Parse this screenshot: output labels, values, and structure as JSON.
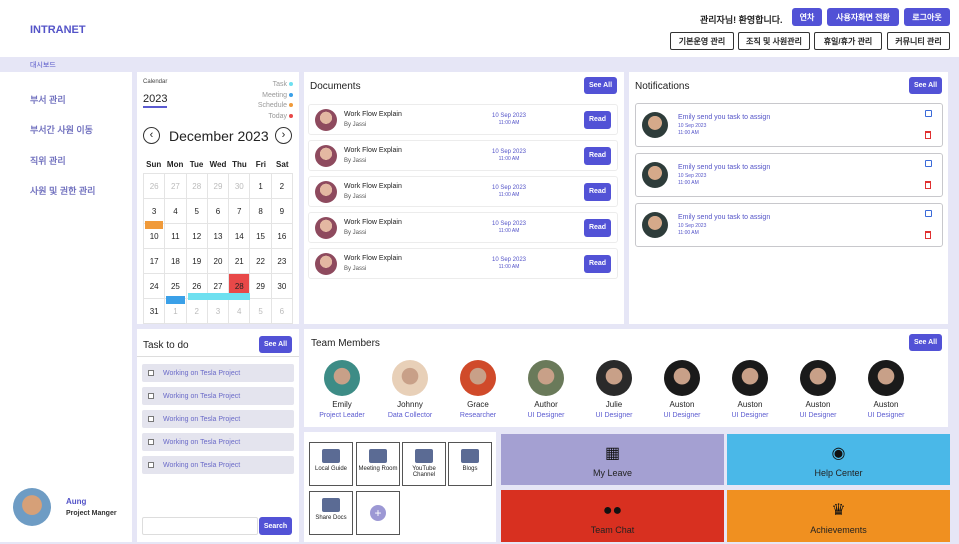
{
  "brand": "INTRANET",
  "header": {
    "welcome": "관리자님! 환영합니다.",
    "btn_leave": "연차",
    "btn_switch": "사용자화면 전환",
    "btn_logout": "로그아웃",
    "tabs": [
      "기본운영 관리",
      "조직 및 사원관리",
      "휴일/휴가 관리",
      "커뮤니티 관리"
    ]
  },
  "breadcrumb": "대시보드",
  "sidebar": {
    "items": [
      "부서 관리",
      "부서간 사원 이동",
      "직위 관리",
      "사원 및 권한 관리"
    ],
    "user_name": "Aung",
    "user_role": "Project Manger"
  },
  "calendar": {
    "label": "Calendar",
    "year": "2023",
    "month": "December 2023",
    "legend": [
      {
        "label": "Task",
        "color": "#6ee0f0"
      },
      {
        "label": "Meeting",
        "color": "#3aa0e8"
      },
      {
        "label": "Schedule",
        "color": "#f09a3a"
      },
      {
        "label": "Today",
        "color": "#e84848"
      }
    ],
    "dows": [
      "Sun",
      "Mon",
      "Tue",
      "Wed",
      "Thu",
      "Fri",
      "Sat"
    ],
    "weeks": [
      [
        "26",
        "27",
        "28",
        "29",
        "30",
        "1",
        "2"
      ],
      [
        "3",
        "4",
        "5",
        "6",
        "7",
        "8",
        "9"
      ],
      [
        "10",
        "11",
        "12",
        "13",
        "14",
        "15",
        "16"
      ],
      [
        "17",
        "18",
        "19",
        "20",
        "21",
        "22",
        "23"
      ],
      [
        "24",
        "25",
        "26",
        "27",
        "28",
        "29",
        "30"
      ],
      [
        "31",
        "1",
        "2",
        "3",
        "4",
        "5",
        "6"
      ]
    ],
    "prev_icon": "chevron-left-icon",
    "next_icon": "chevron-right-icon"
  },
  "documents": {
    "title": "Documents",
    "see_all": "See All",
    "items": [
      {
        "name": "Work Flow Explain",
        "by": "By Jassi",
        "date": "10 Sep 2023",
        "time": "11:00 AM",
        "action": "Read"
      },
      {
        "name": "Work Flow Explain",
        "by": "By Jassi",
        "date": "10 Sep 2023",
        "time": "11:00 AM",
        "action": "Read"
      },
      {
        "name": "Work Flow Explain",
        "by": "By Jassi",
        "date": "10 Sep 2023",
        "time": "11:00 AM",
        "action": "Read"
      },
      {
        "name": "Work Flow Explain",
        "by": "By Jassi",
        "date": "10 Sep 2023",
        "time": "11:00 AM",
        "action": "Read"
      },
      {
        "name": "Work Flow Explain",
        "by": "By Jassi",
        "date": "10 Sep 2023",
        "time": "11:00 AM",
        "action": "Read"
      }
    ]
  },
  "notifications": {
    "title": "Notifications",
    "see_all": "See All",
    "items": [
      {
        "text": "Emily send you task to assign",
        "date": "10 Sep 2023",
        "time": "11:00 AM"
      },
      {
        "text": "Emily send you task to assign",
        "date": "10 Sep 2023",
        "time": "11:00 AM"
      },
      {
        "text": "Emily send you task to assign",
        "date": "10 Sep 2023",
        "time": "11:00 AM"
      }
    ]
  },
  "tasks": {
    "title": "Task to do",
    "see_all": "See All",
    "items": [
      "Working on Tesla Project",
      "Working on Tesla Project",
      "Working on Tesla Project",
      "Working on Tesla Project",
      "Working on Tesla Project"
    ],
    "search_placeholder": "",
    "search_label": "Search"
  },
  "team": {
    "title": "Team Members",
    "see_all": "See All",
    "members": [
      {
        "name": "Emily",
        "role": "Project Leader",
        "color": "#3d8c86"
      },
      {
        "name": "Johnny",
        "role": "Data Collector",
        "color": "#e8d0b8"
      },
      {
        "name": "Grace",
        "role": "Researcher",
        "color": "#d04a2a"
      },
      {
        "name": "Author",
        "role": "UI Designer",
        "color": "#6a7a5a"
      },
      {
        "name": "Julie",
        "role": "UI Designer",
        "color": "#2a2a2a"
      },
      {
        "name": "Auston",
        "role": "UI Designer",
        "color": "#1a1a1a"
      },
      {
        "name": "Auston",
        "role": "UI Designer",
        "color": "#1a1a1a"
      },
      {
        "name": "Auston",
        "role": "UI Designer",
        "color": "#1a1a1a"
      },
      {
        "name": "Auston",
        "role": "UI Designer",
        "color": "#1a1a1a"
      }
    ]
  },
  "quick_links": [
    {
      "label": "Local Guide",
      "icon": "map-pin-icon"
    },
    {
      "label": "Meeting Room",
      "icon": "meeting-icon"
    },
    {
      "label": "YouTube Channel",
      "icon": "youtube-icon"
    },
    {
      "label": "Blogs",
      "icon": "blog-icon"
    },
    {
      "label": "Share Docs",
      "icon": "share-icon"
    },
    {
      "label": "",
      "icon": "plus-icon"
    }
  ],
  "big_tiles": [
    {
      "label": "My Leave",
      "icon": "calendar-icon",
      "color": "#a4a0d2"
    },
    {
      "label": "Help Center",
      "icon": "headset-icon",
      "color": "#4ab8e8"
    },
    {
      "label": "Team Chat",
      "icon": "group-icon",
      "color": "#d83020"
    },
    {
      "label": "Achievements",
      "icon": "trophy-icon",
      "color": "#f09020"
    }
  ]
}
